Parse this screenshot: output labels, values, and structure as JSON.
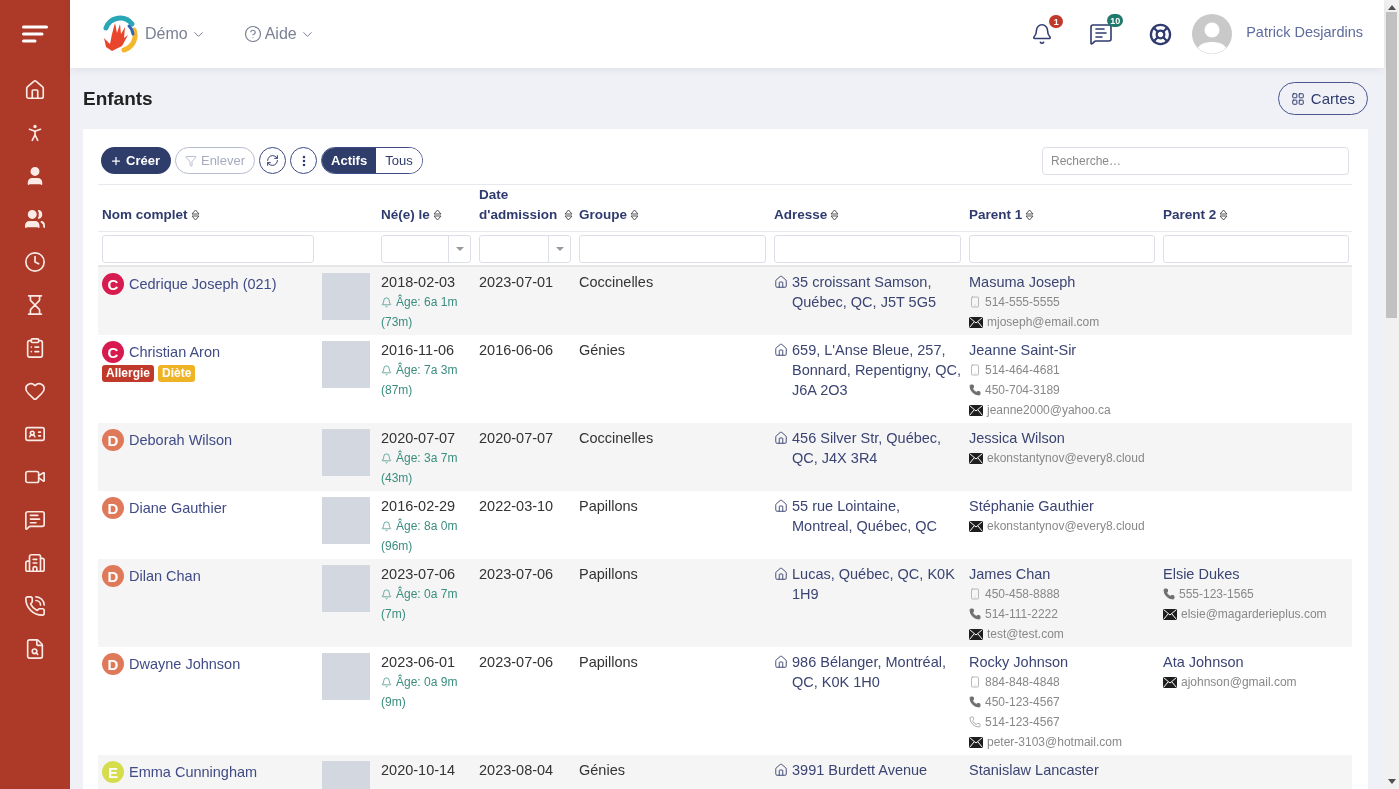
{
  "sidebar": {
    "items": [
      {
        "kind": "menu"
      },
      {
        "kind": "home"
      },
      {
        "kind": "child"
      },
      {
        "kind": "user"
      },
      {
        "kind": "users"
      },
      {
        "kind": "clock"
      },
      {
        "kind": "hourglass"
      },
      {
        "kind": "clipboard"
      },
      {
        "kind": "heart"
      },
      {
        "kind": "idcard"
      },
      {
        "kind": "video"
      },
      {
        "kind": "chat"
      },
      {
        "kind": "building"
      },
      {
        "kind": "phonecall"
      },
      {
        "kind": "report"
      }
    ]
  },
  "topbar": {
    "menus": [
      {
        "kind": "logo",
        "label": "Démo"
      },
      {
        "kind": "help",
        "label": "Aide"
      }
    ],
    "notifications": {
      "badge": "1"
    },
    "messages": {
      "badge": "10"
    },
    "user": {
      "name": "Patrick Desjardins"
    }
  },
  "page": {
    "title": "Enfants",
    "view_button": "Cartes"
  },
  "toolbar": {
    "create": "Créer",
    "remove": {
      "label": "Enlever",
      "disabled": true
    },
    "filters": [
      {
        "label": "Actifs",
        "selected": true
      },
      {
        "label": "Tous",
        "selected": false
      }
    ],
    "search": {
      "placeholder": "Recherche…"
    }
  },
  "table": {
    "columns": [
      {
        "label": "Nom complet",
        "kind": "text"
      },
      {
        "label": "Né(e) le",
        "kind": "date"
      },
      {
        "label": "Date d'admission",
        "kind": "date"
      },
      {
        "label": "Groupe",
        "kind": "text"
      },
      {
        "label": "Adresse",
        "kind": "text"
      },
      {
        "label": "Parent 1",
        "kind": "text"
      },
      {
        "label": "Parent 2",
        "kind": "text"
      }
    ],
    "rows": [
      {
        "initial": "C",
        "color": "#d81b4f",
        "name": "Cedrique Joseph (021)",
        "born": "2018-02-03",
        "age": "Âge: 6a 1m",
        "months": "(73m)",
        "admitted": "2023-07-01",
        "group": "Coccinelles",
        "address": "35 croissant Samson, Québec, QC, J5T 5G5",
        "parents": [
          {
            "name": "Masuma Joseph",
            "contacts": [
              {
                "kind": "mobile",
                "value": "514-555-5555"
              },
              {
                "kind": "email",
                "value": "mjoseph@email.com"
              }
            ]
          }
        ]
      },
      {
        "initial": "C",
        "color": "#d81b4f",
        "name": "Christian Aron",
        "tags": [
          {
            "label": "Allergie",
            "color": "#bf3a2b"
          },
          {
            "label": "Diète",
            "color": "#efb426"
          }
        ],
        "born": "2016-11-06",
        "age": "Âge: 7a 3m",
        "months": "(87m)",
        "admitted": "2016-06-06",
        "group": "Génies",
        "address": "659, L'Anse Bleue, 257, Bonnard, Repentigny, QC, J6A 2O3",
        "parents": [
          {
            "name": "Jeanne Saint-Sir",
            "contacts": [
              {
                "kind": "mobile",
                "value": "514-464-4681"
              },
              {
                "kind": "phone",
                "value": "450-704-3189"
              },
              {
                "kind": "email",
                "value": "jeanne2000@yahoo.ca"
              }
            ]
          }
        ]
      },
      {
        "initial": "D",
        "color": "#e0795a",
        "name": "Deborah Wilson",
        "born": "2020-07-07",
        "age": "Âge: 3a 7m",
        "months": "(43m)",
        "admitted": "2020-07-07",
        "group": "Coccinelles",
        "address": "456 Silver Str, Québec, QC, J4X 3R4",
        "parents": [
          {
            "name": "Jessica Wilson",
            "contacts": [
              {
                "kind": "email",
                "value": "ekonstantynov@every8.cloud"
              }
            ]
          }
        ]
      },
      {
        "initial": "D",
        "color": "#e0795a",
        "name": "Diane Gauthier",
        "born": "2016-02-29",
        "age": "Âge: 8a 0m",
        "months": "(96m)",
        "admitted": "2022-03-10",
        "group": "Papillons",
        "address": "55 rue Lointaine, Montreal, Québec, QC",
        "parents": [
          {
            "name": "Stéphanie Gauthier",
            "contacts": [
              {
                "kind": "email",
                "value": "ekonstantynov@every8.cloud"
              }
            ]
          }
        ]
      },
      {
        "initial": "D",
        "color": "#e0795a",
        "name": "Dilan Chan",
        "born": "2023-07-06",
        "age": "Âge: 0a 7m",
        "months": "(7m)",
        "admitted": "2023-07-06",
        "group": "Papillons",
        "address": "Lucas, Québec, QC, K0K 1H9",
        "parents": [
          {
            "name": "James Chan",
            "contacts": [
              {
                "kind": "mobile",
                "value": "450-458-8888"
              },
              {
                "kind": "phone",
                "value": "514-111-2222"
              },
              {
                "kind": "email",
                "value": "test@test.com"
              }
            ]
          },
          {
            "name": "Elsie Dukes",
            "contacts": [
              {
                "kind": "phone",
                "value": "555-123-1565"
              },
              {
                "kind": "email",
                "value": "elsie@magarderieplus.com"
              }
            ]
          }
        ]
      },
      {
        "initial": "D",
        "color": "#e0795a",
        "name": "Dwayne Johnson",
        "born": "2023-06-01",
        "age": "Âge: 0a 9m",
        "months": "(9m)",
        "admitted": "2023-07-06",
        "group": "Papillons",
        "address": "986 Bélanger, Montréal, QC, K0K 1H0",
        "parents": [
          {
            "name": "Rocky Johnson",
            "contacts": [
              {
                "kind": "mobile",
                "value": "884-848-4848"
              },
              {
                "kind": "phone",
                "value": "450-123-4567"
              },
              {
                "kind": "phone_outline",
                "value": "514-123-4567"
              },
              {
                "kind": "email",
                "value": "peter-3103@hotmail.com"
              }
            ]
          },
          {
            "name": "Ata Johnson",
            "contacts": [
              {
                "kind": "email",
                "value": "ajohnson@gmail.com"
              }
            ]
          }
        ]
      },
      {
        "initial": "E",
        "color": "#d6dd4c",
        "name": "Emma Cunningham",
        "born": "2020-10-14",
        "admitted": "2023-08-04",
        "group": "Génies",
        "address": "3991 Burdett Avenue",
        "parents": [
          {
            "name": "Stanislaw Lancaster"
          }
        ]
      }
    ]
  }
}
